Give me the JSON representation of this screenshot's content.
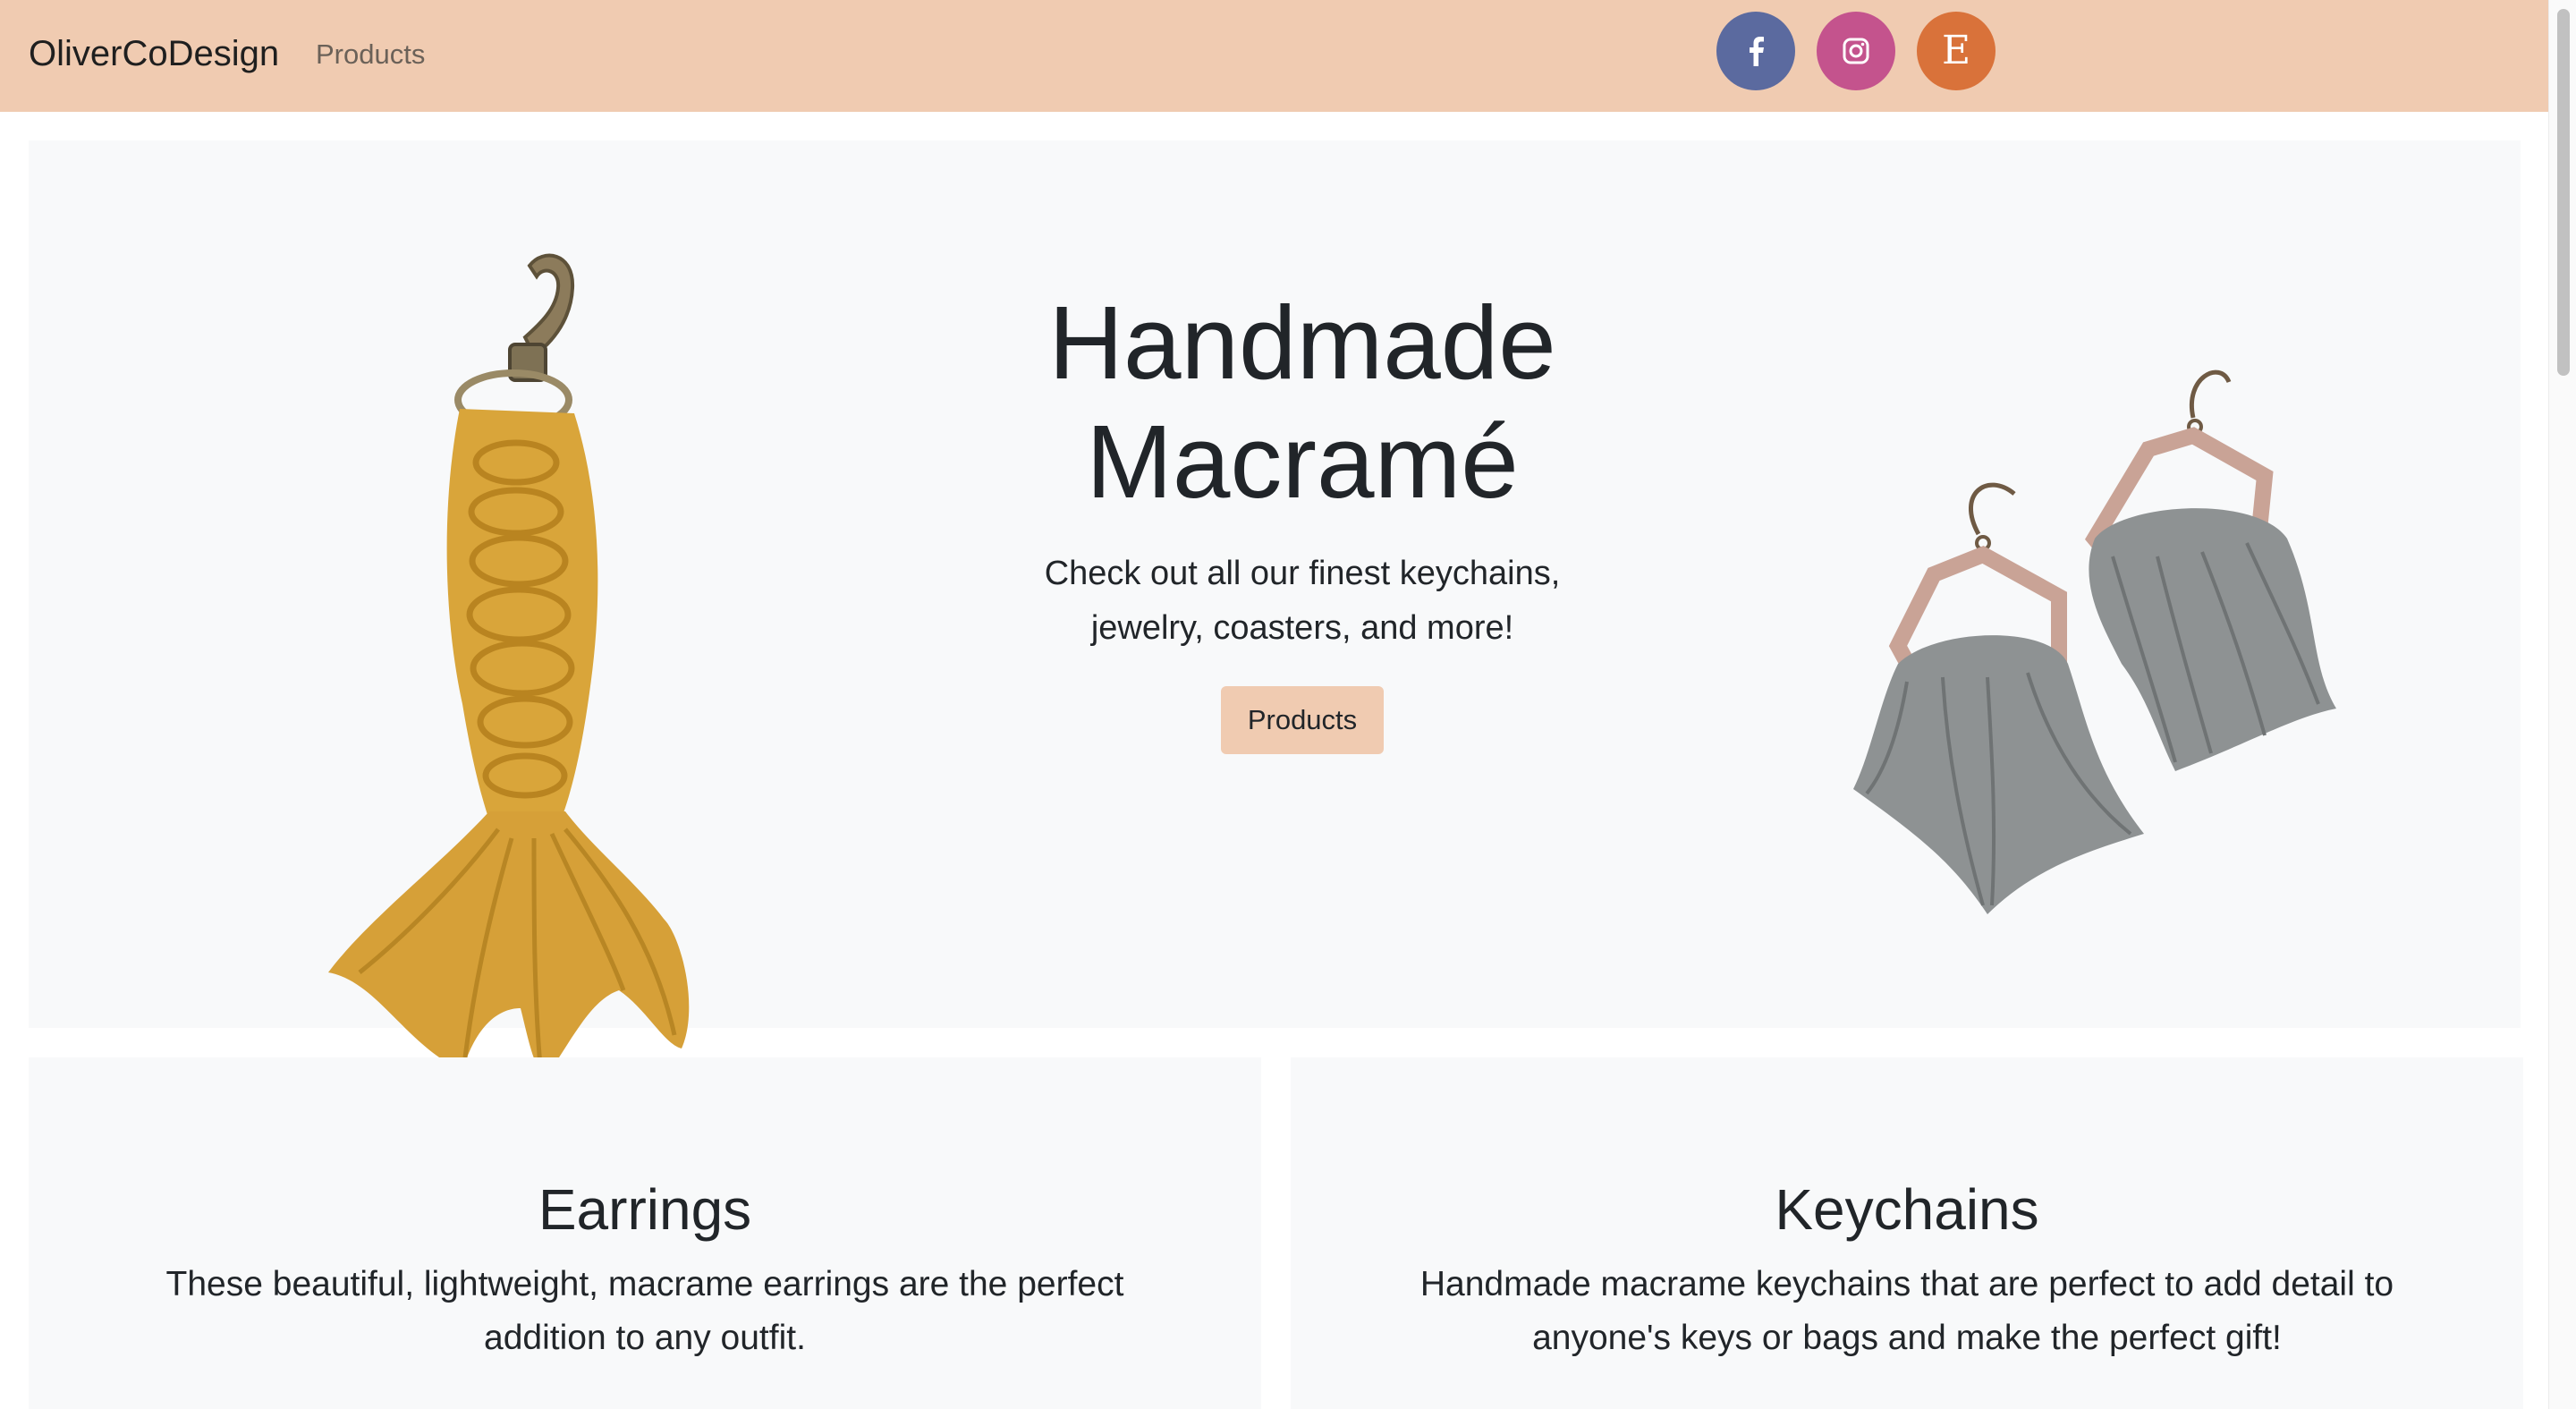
{
  "navbar": {
    "brand": "OliverCoDesign",
    "links": [
      {
        "label": "Products"
      }
    ],
    "social": [
      {
        "name": "facebook-icon",
        "color": "#5b6a9f"
      },
      {
        "name": "instagram-icon",
        "color": "#c4538d"
      },
      {
        "name": "etsy-icon",
        "letter": "E",
        "color": "#d9723a"
      }
    ],
    "background": "#f0cbb1"
  },
  "hero": {
    "title_line1": "Handmade",
    "title_line2": "Macramé",
    "subtitle": "Check out all our finest keychains, jewelry, coasters, and more!",
    "button_label": "Products",
    "images": [
      "macrame-keychain-image",
      "macrame-earrings-image"
    ]
  },
  "cards": [
    {
      "title": "Earrings",
      "text": "These beautiful, lightweight, macrame earrings are the perfect addition to any outfit."
    },
    {
      "title": "Keychains",
      "text": "Handmade macrame keychains that are perfect to add detail to anyone's keys or bags and make the perfect gift!"
    }
  ],
  "colors": {
    "accent": "#f0cbb1",
    "panel": "#f8f9fa",
    "text": "#212529",
    "keychain": "#d9a53a",
    "earring_fringe": "#8e9293",
    "earring_wood": "#c9a396"
  }
}
